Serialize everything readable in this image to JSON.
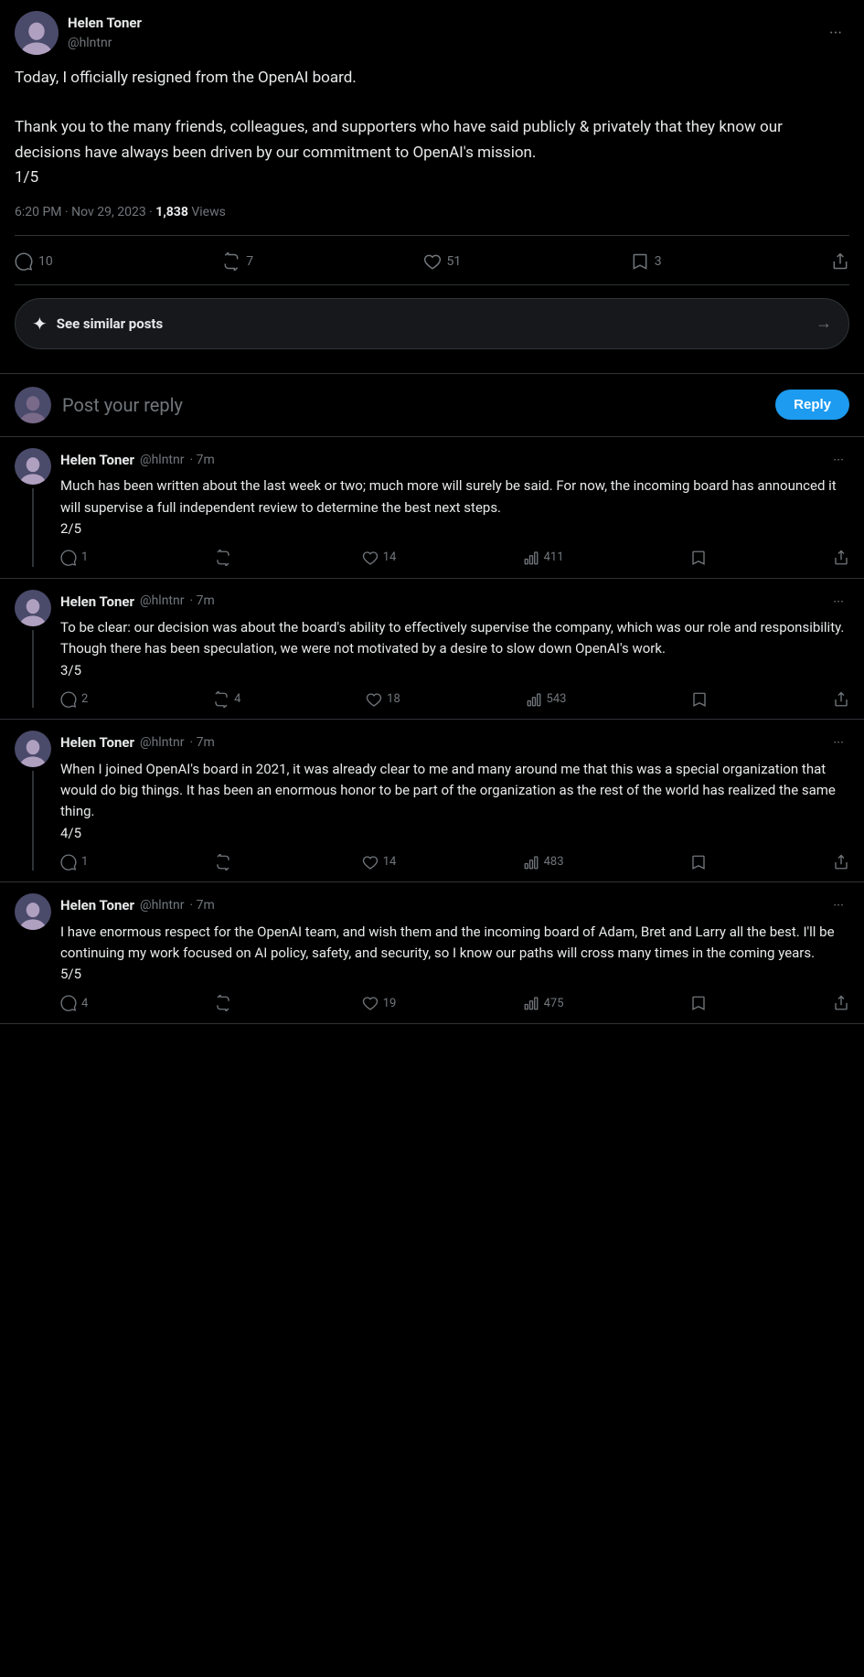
{
  "main_tweet": {
    "user": {
      "display_name": "Helen Toner",
      "handle": "@hlntnr"
    },
    "text_lines": [
      "Today, I officially resigned from the OpenAI board.",
      "",
      "Thank you to the many friends, colleagues, and supporters who have said publicly & privately that they know our decisions have always been driven by our commitment to OpenAI's mission.",
      "1/5"
    ],
    "timestamp": "6:20 PM · Nov 29, 2023 · ",
    "views_count": "1,838",
    "views_label": " Views",
    "actions": {
      "comments": "10",
      "retweets": "7",
      "likes": "51",
      "bookmarks": "3"
    }
  },
  "similar_posts": {
    "label": "See similar posts",
    "icon": "sparkle"
  },
  "reply_box": {
    "placeholder": "Post your reply",
    "button_label": "Reply"
  },
  "replies": [
    {
      "user": {
        "display_name": "Helen Toner",
        "handle": "@hlntnr",
        "time": "7m"
      },
      "text": "Much has been written about the last week or two; much more will surely be said. For now, the incoming board has announced it will supervise a full independent review to determine the best next steps.\n2/5",
      "actions": {
        "comments": "1",
        "retweets": "",
        "likes": "14",
        "views": "411",
        "bookmarks": ""
      }
    },
    {
      "user": {
        "display_name": "Helen Toner",
        "handle": "@hlntnr",
        "time": "7m"
      },
      "text": "To be clear: our decision was about the board's ability to effectively supervise the company, which was our role and responsibility. Though there has been speculation, we were not motivated by a desire to slow down OpenAI's work.\n3/5",
      "actions": {
        "comments": "2",
        "retweets": "4",
        "likes": "18",
        "views": "543",
        "bookmarks": ""
      }
    },
    {
      "user": {
        "display_name": "Helen Toner",
        "handle": "@hlntnr",
        "time": "7m"
      },
      "text": "When I joined OpenAI's board in 2021, it was already clear to me and many around me that this was a special organization that would do big things. It has been an enormous honor to be part of the organization as the rest of the world has realized the same thing.\n4/5",
      "actions": {
        "comments": "1",
        "retweets": "",
        "likes": "14",
        "views": "483",
        "bookmarks": ""
      }
    },
    {
      "user": {
        "display_name": "Helen Toner",
        "handle": "@hlntnr",
        "time": "7m"
      },
      "text": "I have enormous respect for the OpenAI team, and wish them and the incoming board of Adam, Bret and Larry all the best. I'll be continuing my work focused on AI policy, safety, and security, so I know our paths will cross many times in the coming years.\n5/5",
      "actions": {
        "comments": "4",
        "retweets": "",
        "likes": "19",
        "views": "475",
        "bookmarks": ""
      }
    }
  ]
}
